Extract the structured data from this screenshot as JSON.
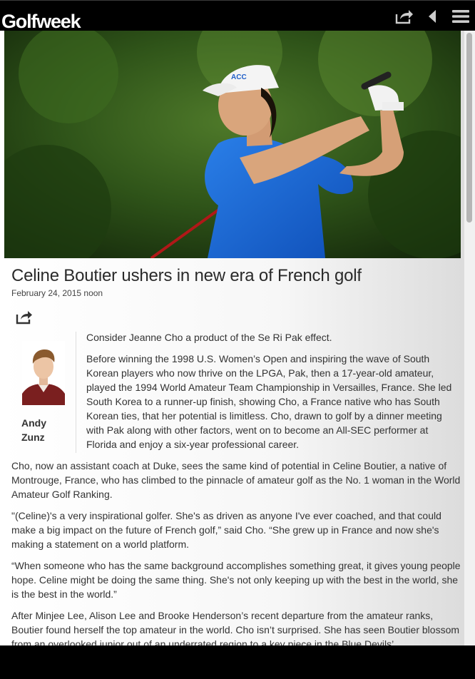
{
  "header": {
    "logo": "Golfweek",
    "icons": [
      "share-icon",
      "back-arrow-icon",
      "menu-icon"
    ]
  },
  "article": {
    "title": "Celine Boutier ushers in new era of French golf",
    "date": "February 24, 2015 noon",
    "author": {
      "first": "Andy",
      "last": "Zunz"
    },
    "paragraphs": [
      "Consider Jeanne Cho a product of the Se Ri Pak effect.",
      "Before winning the 1998 U.S. Women’s Open and inspiring the wave of South Korean players who now thrive on the LPGA, Pak, then a 17-year-old amateur, played the 1994 World Amateur Team Championship in Versailles, France. She led South Korea to a runner-up finish, showing Cho, a France native who has South Korean ties, that her potential is limitless. Cho, drawn to golf by a dinner meeting with Pak along with other factors, went on to become an All-SEC performer at Florida and enjoy a six-year professional career.",
      "Cho, now an assistant coach at Duke, sees the same kind of potential in Celine Boutier, a native of Montrouge, France, who has climbed to the pinnacle of amateur golf as the No. 1 woman in the World Amateur Golf Ranking.",
      "\"(Celine)'s a very inspirational golfer. She's as driven as anyone I've ever coached, and that could make a big impact on the future of French golf,” said Cho. “She grew up in France and now she's making a statement on a world platform.",
      "“When someone who has the same background accomplishes something great, it gives young people hope. Celine might be doing the same thing. She's not only keeping up with the best in the world, she is the best in the world.”",
      "After Minjee Lee, Alison Lee and Brooke Henderson’s recent departure from the amateur ranks, Boutier found herself the top amateur in the world. Cho isn’t surprised. She has seen Boutier blossom from an overlooked junior out of an underrated region to a key piece in the Blue Devils’"
    ]
  },
  "colors": {
    "topbar": "#000000",
    "title": "#2a2a2a",
    "body_text": "#333333",
    "scrollbar_thumb": "#b5b5b5"
  }
}
